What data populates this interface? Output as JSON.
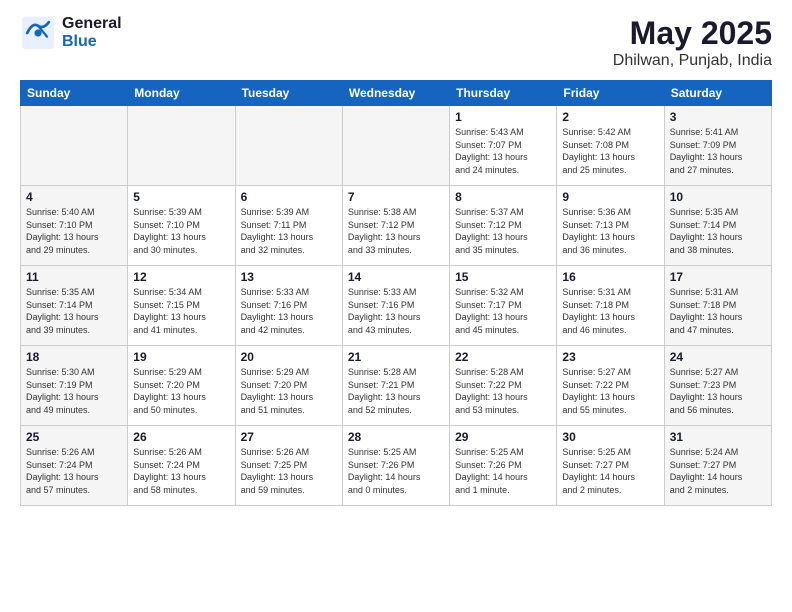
{
  "header": {
    "logo_general": "General",
    "logo_blue": "Blue",
    "month_year": "May 2025",
    "location": "Dhilwan, Punjab, India"
  },
  "days_of_week": [
    "Sunday",
    "Monday",
    "Tuesday",
    "Wednesday",
    "Thursday",
    "Friday",
    "Saturday"
  ],
  "weeks": [
    [
      {
        "day": "",
        "info": ""
      },
      {
        "day": "",
        "info": ""
      },
      {
        "day": "",
        "info": ""
      },
      {
        "day": "",
        "info": ""
      },
      {
        "day": "1",
        "info": "Sunrise: 5:43 AM\nSunset: 7:07 PM\nDaylight: 13 hours\nand 24 minutes."
      },
      {
        "day": "2",
        "info": "Sunrise: 5:42 AM\nSunset: 7:08 PM\nDaylight: 13 hours\nand 25 minutes."
      },
      {
        "day": "3",
        "info": "Sunrise: 5:41 AM\nSunset: 7:09 PM\nDaylight: 13 hours\nand 27 minutes."
      }
    ],
    [
      {
        "day": "4",
        "info": "Sunrise: 5:40 AM\nSunset: 7:10 PM\nDaylight: 13 hours\nand 29 minutes."
      },
      {
        "day": "5",
        "info": "Sunrise: 5:39 AM\nSunset: 7:10 PM\nDaylight: 13 hours\nand 30 minutes."
      },
      {
        "day": "6",
        "info": "Sunrise: 5:39 AM\nSunset: 7:11 PM\nDaylight: 13 hours\nand 32 minutes."
      },
      {
        "day": "7",
        "info": "Sunrise: 5:38 AM\nSunset: 7:12 PM\nDaylight: 13 hours\nand 33 minutes."
      },
      {
        "day": "8",
        "info": "Sunrise: 5:37 AM\nSunset: 7:12 PM\nDaylight: 13 hours\nand 35 minutes."
      },
      {
        "day": "9",
        "info": "Sunrise: 5:36 AM\nSunset: 7:13 PM\nDaylight: 13 hours\nand 36 minutes."
      },
      {
        "day": "10",
        "info": "Sunrise: 5:35 AM\nSunset: 7:14 PM\nDaylight: 13 hours\nand 38 minutes."
      }
    ],
    [
      {
        "day": "11",
        "info": "Sunrise: 5:35 AM\nSunset: 7:14 PM\nDaylight: 13 hours\nand 39 minutes."
      },
      {
        "day": "12",
        "info": "Sunrise: 5:34 AM\nSunset: 7:15 PM\nDaylight: 13 hours\nand 41 minutes."
      },
      {
        "day": "13",
        "info": "Sunrise: 5:33 AM\nSunset: 7:16 PM\nDaylight: 13 hours\nand 42 minutes."
      },
      {
        "day": "14",
        "info": "Sunrise: 5:33 AM\nSunset: 7:16 PM\nDaylight: 13 hours\nand 43 minutes."
      },
      {
        "day": "15",
        "info": "Sunrise: 5:32 AM\nSunset: 7:17 PM\nDaylight: 13 hours\nand 45 minutes."
      },
      {
        "day": "16",
        "info": "Sunrise: 5:31 AM\nSunset: 7:18 PM\nDaylight: 13 hours\nand 46 minutes."
      },
      {
        "day": "17",
        "info": "Sunrise: 5:31 AM\nSunset: 7:18 PM\nDaylight: 13 hours\nand 47 minutes."
      }
    ],
    [
      {
        "day": "18",
        "info": "Sunrise: 5:30 AM\nSunset: 7:19 PM\nDaylight: 13 hours\nand 49 minutes."
      },
      {
        "day": "19",
        "info": "Sunrise: 5:29 AM\nSunset: 7:20 PM\nDaylight: 13 hours\nand 50 minutes."
      },
      {
        "day": "20",
        "info": "Sunrise: 5:29 AM\nSunset: 7:20 PM\nDaylight: 13 hours\nand 51 minutes."
      },
      {
        "day": "21",
        "info": "Sunrise: 5:28 AM\nSunset: 7:21 PM\nDaylight: 13 hours\nand 52 minutes."
      },
      {
        "day": "22",
        "info": "Sunrise: 5:28 AM\nSunset: 7:22 PM\nDaylight: 13 hours\nand 53 minutes."
      },
      {
        "day": "23",
        "info": "Sunrise: 5:27 AM\nSunset: 7:22 PM\nDaylight: 13 hours\nand 55 minutes."
      },
      {
        "day": "24",
        "info": "Sunrise: 5:27 AM\nSunset: 7:23 PM\nDaylight: 13 hours\nand 56 minutes."
      }
    ],
    [
      {
        "day": "25",
        "info": "Sunrise: 5:26 AM\nSunset: 7:24 PM\nDaylight: 13 hours\nand 57 minutes."
      },
      {
        "day": "26",
        "info": "Sunrise: 5:26 AM\nSunset: 7:24 PM\nDaylight: 13 hours\nand 58 minutes."
      },
      {
        "day": "27",
        "info": "Sunrise: 5:26 AM\nSunset: 7:25 PM\nDaylight: 13 hours\nand 59 minutes."
      },
      {
        "day": "28",
        "info": "Sunrise: 5:25 AM\nSunset: 7:26 PM\nDaylight: 14 hours\nand 0 minutes."
      },
      {
        "day": "29",
        "info": "Sunrise: 5:25 AM\nSunset: 7:26 PM\nDaylight: 14 hours\nand 1 minute."
      },
      {
        "day": "30",
        "info": "Sunrise: 5:25 AM\nSunset: 7:27 PM\nDaylight: 14 hours\nand 2 minutes."
      },
      {
        "day": "31",
        "info": "Sunrise: 5:24 AM\nSunset: 7:27 PM\nDaylight: 14 hours\nand 2 minutes."
      }
    ]
  ]
}
